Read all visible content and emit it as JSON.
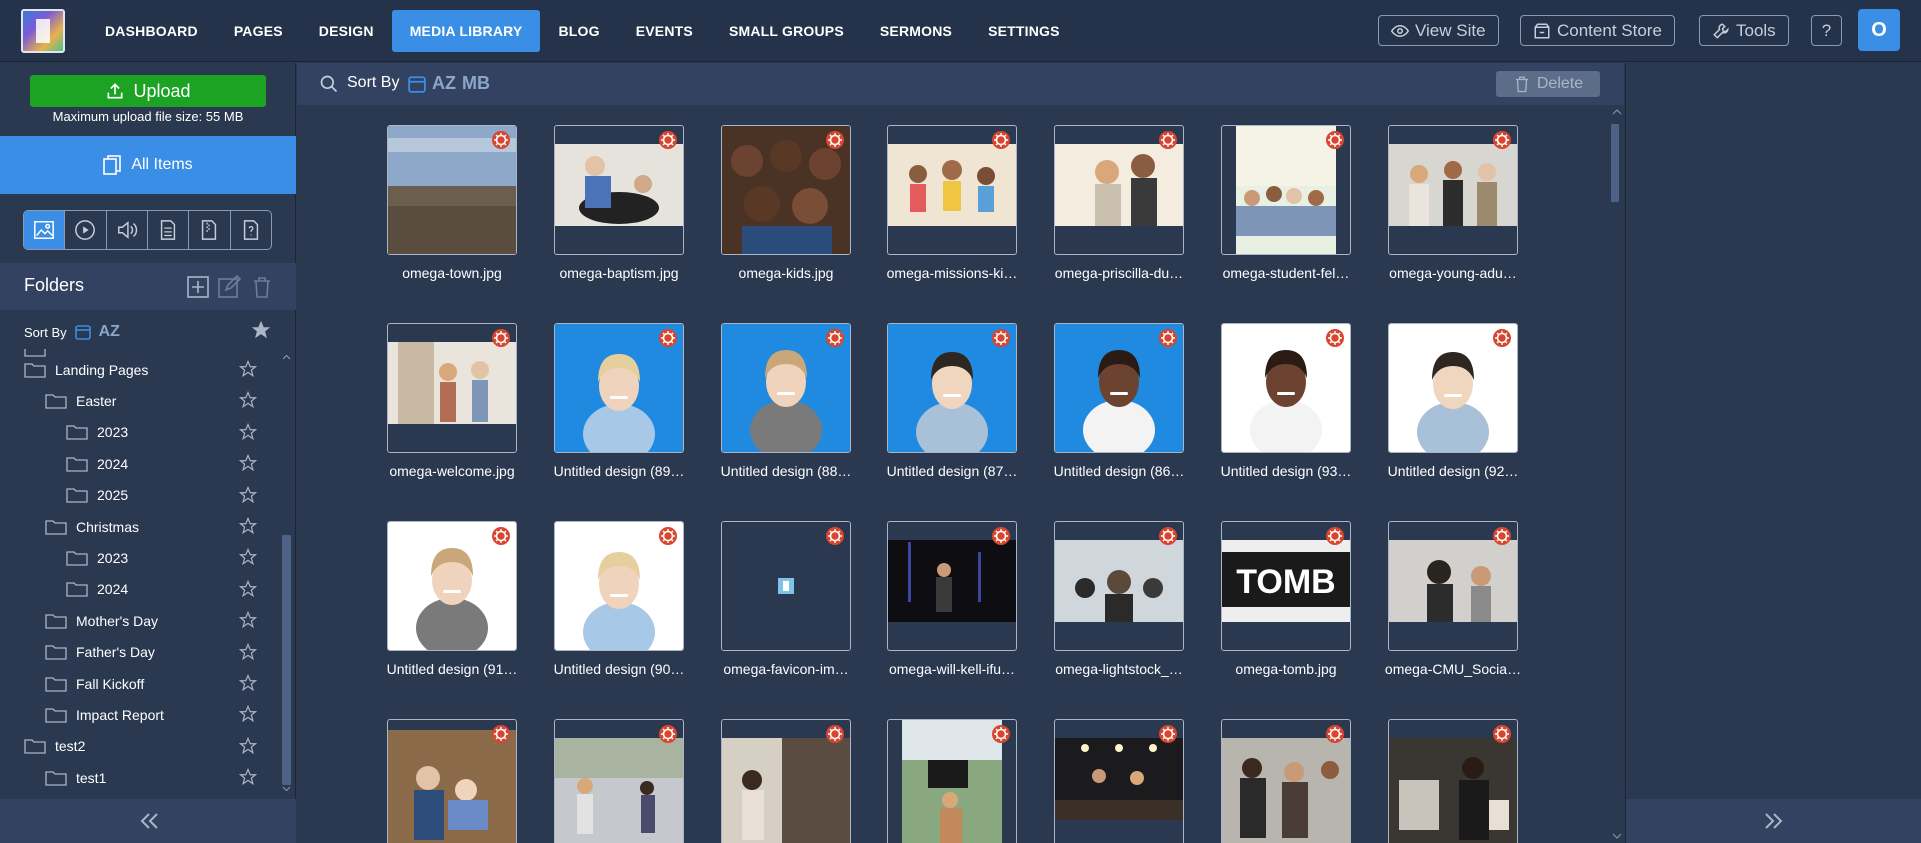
{
  "nav": {
    "items": [
      {
        "label": "DASHBOARD",
        "active": false
      },
      {
        "label": "PAGES",
        "active": false
      },
      {
        "label": "DESIGN",
        "active": false
      },
      {
        "label": "MEDIA LIBRARY",
        "active": true
      },
      {
        "label": "BLOG",
        "active": false
      },
      {
        "label": "EVENTS",
        "active": false
      },
      {
        "label": "SMALL GROUPS",
        "active": false
      },
      {
        "label": "SERMONS",
        "active": false
      },
      {
        "label": "SETTINGS",
        "active": false
      }
    ],
    "view_site": "View Site",
    "content_store": "Content Store",
    "tools": "Tools",
    "help": "?",
    "avatar": "O"
  },
  "sidebar": {
    "upload": "Upload",
    "upload_note": "Maximum upload file size: 55 MB",
    "all_items": "All Items",
    "folders_title": "Folders",
    "sort_label": "Sort By",
    "sort_value": "AZ",
    "tree": [
      {
        "label": "Landing Pages",
        "level": 0
      },
      {
        "label": "Easter",
        "level": 1
      },
      {
        "label": "2023",
        "level": 2
      },
      {
        "label": "2024",
        "level": 2
      },
      {
        "label": "2025",
        "level": 2
      },
      {
        "label": "Christmas",
        "level": 1
      },
      {
        "label": "2023",
        "level": 2
      },
      {
        "label": "2024",
        "level": 2
      },
      {
        "label": "Mother's Day",
        "level": 1
      },
      {
        "label": "Father's Day",
        "level": 1
      },
      {
        "label": "Fall Kickoff",
        "level": 1
      },
      {
        "label": "Impact Report",
        "level": 1
      },
      {
        "label": "test2",
        "level": 0
      },
      {
        "label": "test1",
        "level": 1
      }
    ]
  },
  "main": {
    "sort_label": "Sort By",
    "sort_az": "AZ",
    "sort_mb": "MB",
    "delete": "Delete",
    "files": [
      {
        "name": "omega-town.jpg",
        "kind": "town"
      },
      {
        "name": "omega-baptism.jpg",
        "kind": "baptism"
      },
      {
        "name": "omega-kids.jpg",
        "kind": "kids"
      },
      {
        "name": "omega-missions-ki…",
        "kind": "missions"
      },
      {
        "name": "omega-priscilla-du…",
        "kind": "priscilla"
      },
      {
        "name": "omega-student-fel…",
        "kind": "student"
      },
      {
        "name": "omega-young-adu…",
        "kind": "young"
      },
      {
        "name": "omega-welcome.jpg",
        "kind": "welcome"
      },
      {
        "name": "Untitled design (89…",
        "kind": "blue-woman"
      },
      {
        "name": "Untitled design (88…",
        "kind": "blue-man"
      },
      {
        "name": "Untitled design (87…",
        "kind": "blue-asian"
      },
      {
        "name": "Untitled design (86…",
        "kind": "blue-black"
      },
      {
        "name": "Untitled design (93…",
        "kind": "white-black"
      },
      {
        "name": "Untitled design (92…",
        "kind": "white-asian"
      },
      {
        "name": "Untitled design (91…",
        "kind": "white-man"
      },
      {
        "name": "Untitled design (90…",
        "kind": "white-woman"
      },
      {
        "name": "omega-favicon-im…",
        "kind": "favicon"
      },
      {
        "name": "omega-will-kell-ifu…",
        "kind": "stage"
      },
      {
        "name": "omega-lightstock_…",
        "kind": "worship"
      },
      {
        "name": "omega-tomb.jpg",
        "kind": "tomb"
      },
      {
        "name": "omega-CMU_Socia…",
        "kind": "cmu"
      },
      {
        "name": "",
        "kind": "reading"
      },
      {
        "name": "",
        "kind": "walk"
      },
      {
        "name": "",
        "kind": "door"
      },
      {
        "name": "",
        "kind": "sign"
      },
      {
        "name": "",
        "kind": "dark-room"
      },
      {
        "name": "",
        "kind": "crowd"
      },
      {
        "name": "",
        "kind": "coffee"
      }
    ],
    "tomb_text": "TOMB"
  },
  "colors": {
    "accent": "#3a8ee6",
    "upload_green": "#1ca323",
    "badge_red": "#d9462f",
    "bg": "#2a3850"
  }
}
